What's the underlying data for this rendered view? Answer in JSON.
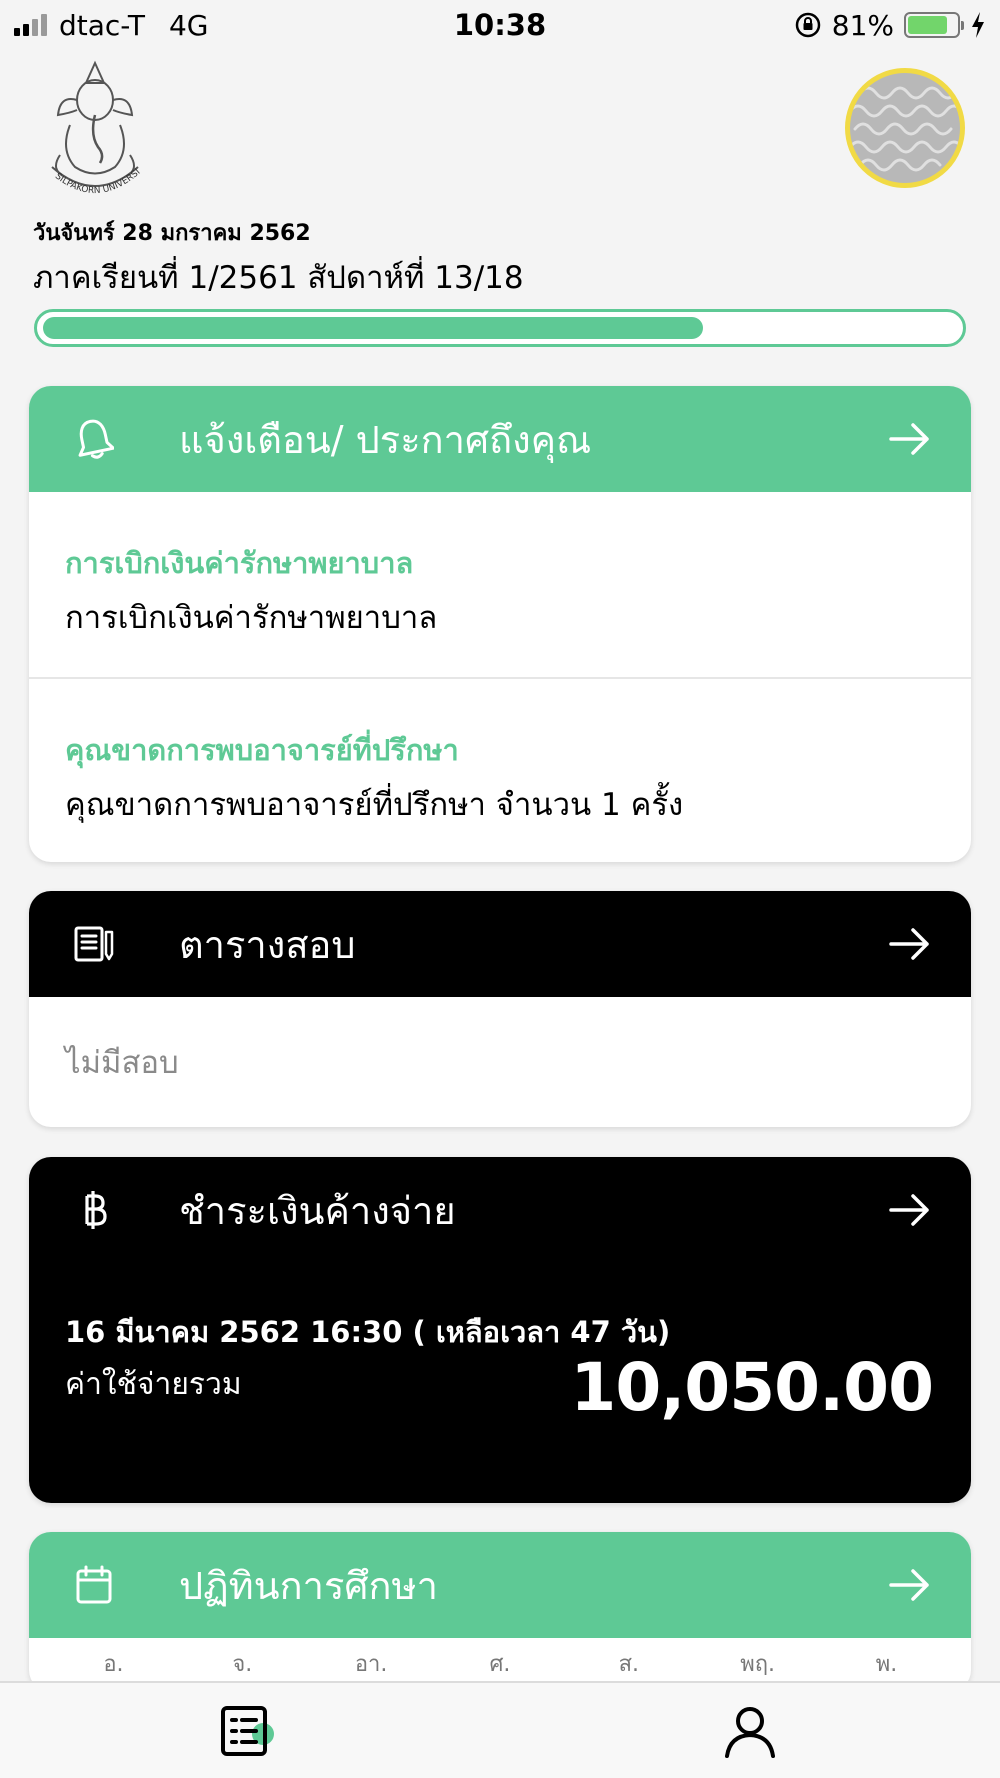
{
  "status_bar": {
    "carrier": "dtac-T",
    "network": "4G",
    "time": "10:38",
    "battery_percent": "81%",
    "battery_level": 0.81
  },
  "header": {
    "logo_text": "SILPAKORN UNIVERSITY",
    "date": "วันจันทร์ 28 มกราคม 2562",
    "term": "ภาคเรียนที่ 1/2561 สัปดาห์ที่ 13/18",
    "progress_fraction": 0.7222
  },
  "notifications": {
    "title": "แจ้งเตือน/ ประกาศถึงคุณ",
    "items": [
      {
        "title": "การเบิกเงินค่ารักษาพยาบาล",
        "body": "การเบิกเงินค่ารักษาพยาบาล"
      },
      {
        "title": "คุณขาดการพบอาจารย์ที่ปรึกษา",
        "body": "คุณขาดการพบอาจารย์ที่ปรึกษา จำนวน 1 ครั้ง"
      }
    ]
  },
  "exam": {
    "title": "ตารางสอบ",
    "empty_text": "ไม่มีสอบ"
  },
  "payment": {
    "title": "ชำระเงินค้างจ่าย",
    "due": "16 มีนาคม 2562 16:30 ( เหลือเวลา 47 วัน)",
    "total_label": "ค่าใช้จ่ายรวม",
    "amount": "10,050.00"
  },
  "calendar": {
    "title": "ปฏิทินการศึกษา",
    "weekdays": [
      "อ.",
      "จ.",
      "อา.",
      "ศ.",
      "ส.",
      "พฤ.",
      "พ."
    ]
  },
  "tabs": [
    {
      "icon": "list-icon",
      "active": true
    },
    {
      "icon": "person-icon",
      "active": false
    }
  ],
  "colors": {
    "accent": "#5ec995",
    "avatar_ring": "#f1da45",
    "card_dark": "#000000"
  }
}
